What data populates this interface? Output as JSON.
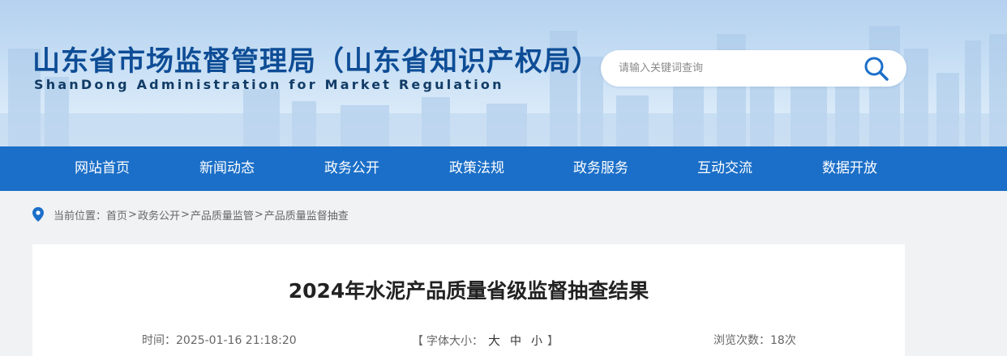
{
  "header": {
    "title": "山东省市场监督管理局（山东省知识产权局）",
    "subtitle": "ShanDong Administration for Market Regulation",
    "search": {
      "placeholder": "请输入关键词查询",
      "value": "",
      "icon": "search-icon"
    }
  },
  "nav": {
    "items": [
      {
        "label": "网站首页"
      },
      {
        "label": "新闻动态"
      },
      {
        "label": "政务公开"
      },
      {
        "label": "政策法规"
      },
      {
        "label": "政务服务"
      },
      {
        "label": "互动交流"
      },
      {
        "label": "数据开放"
      }
    ]
  },
  "breadcrumb": {
    "icon": "location-pin-icon",
    "prefix": "当前位置：",
    "items": [
      "首页",
      "政务公开",
      "产品质量监管",
      "产品质量监督抽查"
    ],
    "separator": ">"
  },
  "article": {
    "title": "2024年水泥产品质量省级监督抽查结果",
    "time_label": "时间：",
    "time_value": "2025-01-16 21:18:20",
    "font_size": {
      "open": "【",
      "label": "字体大小：",
      "large": "大",
      "medium": "中",
      "small": "小",
      "close": "】"
    },
    "views_label": "浏览次数：",
    "views_value": "18次"
  },
  "colors": {
    "nav_bg": "#1b6fc8",
    "title_blue": "#0e4d96",
    "pin_blue": "#1b6fc8"
  }
}
